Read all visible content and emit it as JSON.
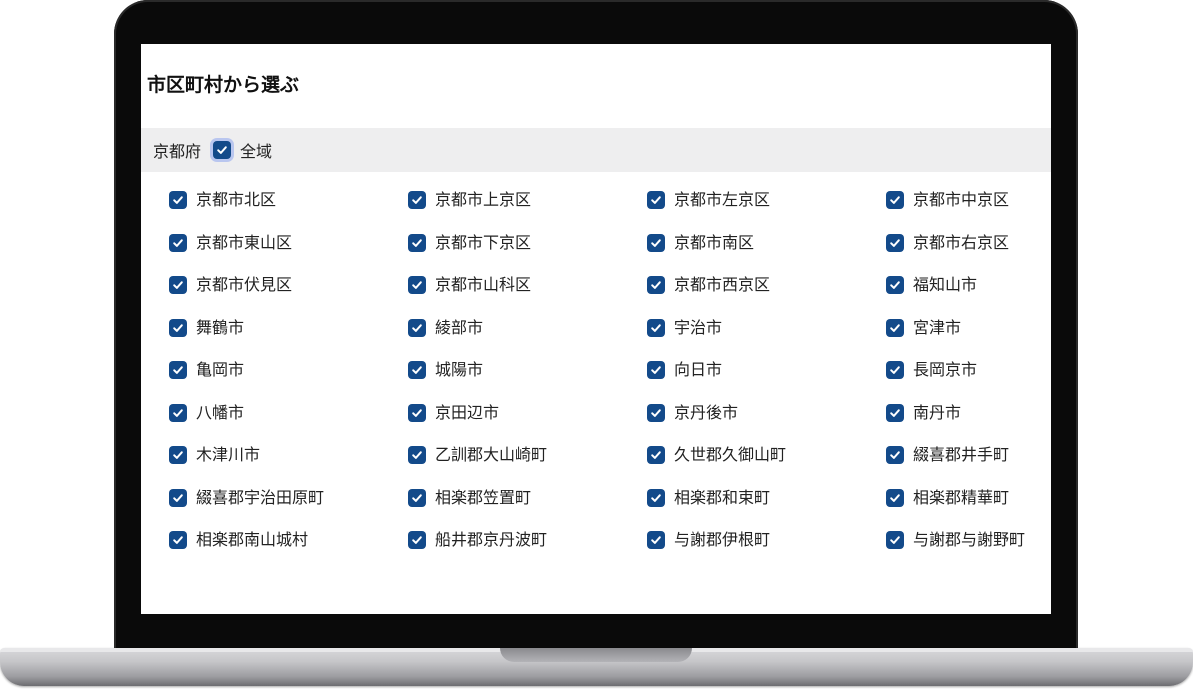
{
  "page": {
    "title": "市区町村から選ぶ"
  },
  "prefecture": {
    "name": "京都府",
    "all_label": "全域",
    "all_checked": true
  },
  "theme": {
    "checkbox_color": "#134a8a",
    "bar_background": "#eeeeef"
  },
  "municipalities": [
    {
      "label": "京都市北区",
      "checked": true
    },
    {
      "label": "京都市上京区",
      "checked": true
    },
    {
      "label": "京都市左京区",
      "checked": true
    },
    {
      "label": "京都市中京区",
      "checked": true
    },
    {
      "label": "京都市東山区",
      "checked": true
    },
    {
      "label": "京都市下京区",
      "checked": true
    },
    {
      "label": "京都市南区",
      "checked": true
    },
    {
      "label": "京都市右京区",
      "checked": true
    },
    {
      "label": "京都市伏見区",
      "checked": true
    },
    {
      "label": "京都市山科区",
      "checked": true
    },
    {
      "label": "京都市西京区",
      "checked": true
    },
    {
      "label": "福知山市",
      "checked": true
    },
    {
      "label": "舞鶴市",
      "checked": true
    },
    {
      "label": "綾部市",
      "checked": true
    },
    {
      "label": "宇治市",
      "checked": true
    },
    {
      "label": "宮津市",
      "checked": true
    },
    {
      "label": "亀岡市",
      "checked": true
    },
    {
      "label": "城陽市",
      "checked": true
    },
    {
      "label": "向日市",
      "checked": true
    },
    {
      "label": "長岡京市",
      "checked": true
    },
    {
      "label": "八幡市",
      "checked": true
    },
    {
      "label": "京田辺市",
      "checked": true
    },
    {
      "label": "京丹後市",
      "checked": true
    },
    {
      "label": "南丹市",
      "checked": true
    },
    {
      "label": "木津川市",
      "checked": true
    },
    {
      "label": "乙訓郡大山崎町",
      "checked": true
    },
    {
      "label": "久世郡久御山町",
      "checked": true
    },
    {
      "label": "綴喜郡井手町",
      "checked": true
    },
    {
      "label": "綴喜郡宇治田原町",
      "checked": true
    },
    {
      "label": "相楽郡笠置町",
      "checked": true
    },
    {
      "label": "相楽郡和束町",
      "checked": true
    },
    {
      "label": "相楽郡精華町",
      "checked": true
    },
    {
      "label": "相楽郡南山城村",
      "checked": true
    },
    {
      "label": "船井郡京丹波町",
      "checked": true
    },
    {
      "label": "与謝郡伊根町",
      "checked": true
    },
    {
      "label": "与謝郡与謝野町",
      "checked": true
    }
  ]
}
